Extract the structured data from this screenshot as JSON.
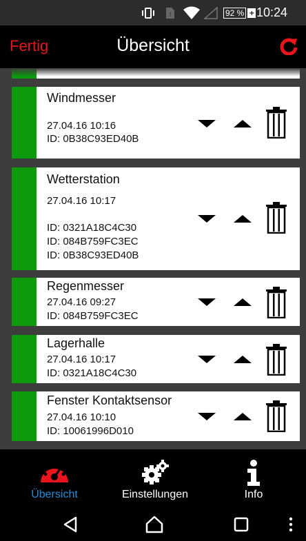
{
  "statusbar": {
    "battery": "92 %",
    "battery_plus": "+",
    "time": "10:24",
    "icons": [
      "vibrate-icon",
      "sim-icon",
      "wifi-icon",
      "signal-icon",
      "battery-icon"
    ]
  },
  "appbar": {
    "done_label": "Fertig",
    "title": "Übersicht",
    "refresh_icon": "refresh-icon"
  },
  "devices": [
    {
      "name": "Windmesser",
      "lines": [
        "27.04.16  10:16",
        "ID: 0B38C93ED40B"
      ]
    },
    {
      "name": "Wetterstation",
      "lines": [
        "27.04.16  10:17",
        "ID: 0321A18C4C30",
        "ID: 084B759FC3EC",
        "ID: 0B38C93ED40B"
      ]
    },
    {
      "name": "Regenmesser",
      "lines": [
        "27.04.16  09:27",
        "ID: 084B759FC3EC"
      ]
    },
    {
      "name": "Lagerhalle",
      "lines": [
        "27.04.16  10:17",
        "ID: 0321A18C4C30"
      ]
    },
    {
      "name": "Fenster Kontaktsensor",
      "lines": [
        "27.04.16  10:10",
        "ID: 10061996D010"
      ]
    }
  ],
  "tabs": [
    {
      "label": "Übersicht",
      "icon": "gauge-icon",
      "active": true
    },
    {
      "label": "Einstellungen",
      "icon": "gears-icon",
      "active": false
    },
    {
      "label": "Info",
      "icon": "info-icon",
      "active": false
    }
  ],
  "colors": {
    "accent_red": "#e8161c",
    "active_tab": "#1e8fd6",
    "status_green": "#0d9b0d"
  },
  "navigation": [
    "back-icon",
    "home-icon",
    "recents-icon",
    "menu-icon"
  ]
}
